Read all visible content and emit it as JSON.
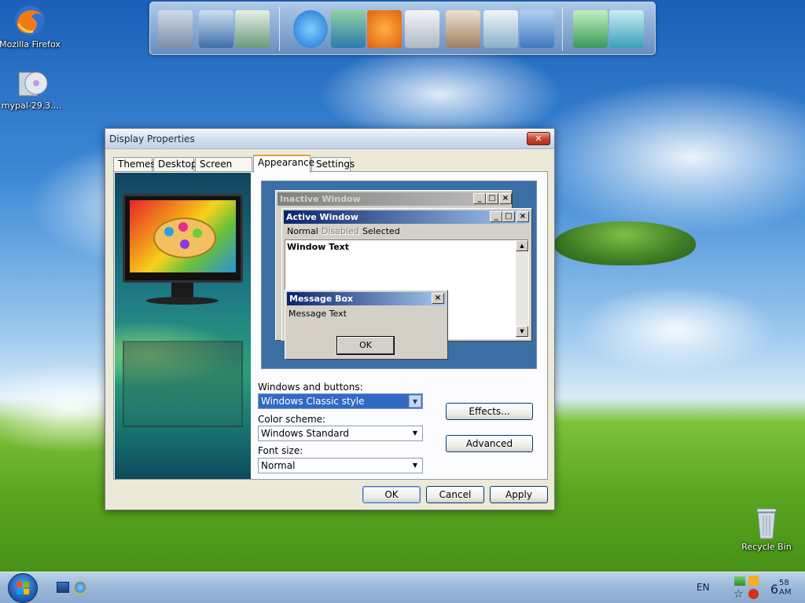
{
  "desktop": {
    "icons": [
      {
        "label": "Mozilla Firefox"
      },
      {
        "label": "mypal-29.3...."
      },
      {
        "label": "Recycle Bin"
      }
    ]
  },
  "dock": {
    "items": [
      "my-computer-icon",
      "network-icon",
      "documents-icon",
      "internet-explorer-icon",
      "remote-desktop-icon",
      "media-player-icon",
      "calculator-icon",
      "paint-icon",
      "notepad-icon",
      "control-panel-icon",
      "tools-icon",
      "recycle-icon"
    ]
  },
  "dialog": {
    "title": "Display Properties",
    "close_label": "✕",
    "tabs": [
      "Themes",
      "Desktop",
      "Screen Saver",
      "Appearance",
      "Settings"
    ],
    "active_tab": "Appearance",
    "preview": {
      "inactive_title": "Inactive Window",
      "active_title": "Active Window",
      "menu": {
        "normal": "Normal",
        "disabled": "Disabled",
        "selected": "Selected"
      },
      "window_text": "Window Text",
      "msgbox_title": "Message Box",
      "msgbox_text": "Message Text",
      "msgbox_ok": "OK"
    },
    "windows_and_buttons": {
      "label": "Windows and buttons:",
      "value": "Windows Classic style"
    },
    "color_scheme": {
      "label": "Color scheme:",
      "value": "Windows Standard"
    },
    "font_size": {
      "label": "Font size:",
      "value": "Normal"
    },
    "effects_label": "Effects...",
    "advanced_label": "Advanced",
    "ok_label": "OK",
    "cancel_label": "Cancel",
    "apply_label": "Apply"
  },
  "taskbar": {
    "language": "EN",
    "clock_hour": "6",
    "clock_min": "58",
    "clock_ampm": "AM"
  },
  "colors": {
    "active_title": "#0a246a",
    "inactive_title": "#808080",
    "preview_bg": "#3a6ea5"
  }
}
